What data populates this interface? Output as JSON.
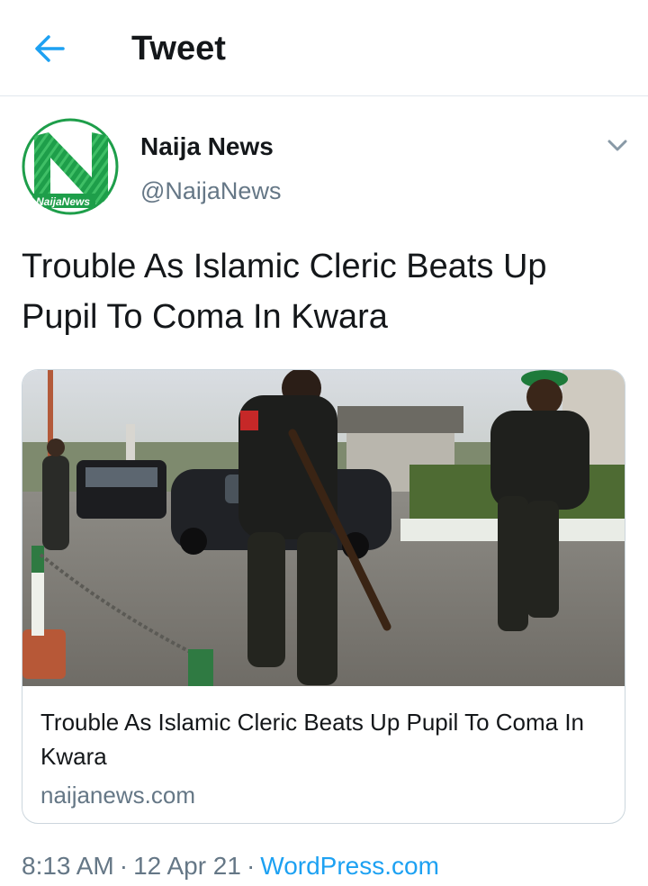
{
  "header": {
    "title": "Tweet",
    "back_icon": "arrow-left-icon",
    "accent": "#1da1f2"
  },
  "author": {
    "name": "Naija News",
    "handle": "@NaijaNews",
    "avatar_logo_text": "NaijaNews",
    "avatar_colors": {
      "green": "#1e9e4a",
      "dark": "#0f6b2e"
    }
  },
  "tweet": {
    "text": "Trouble As Islamic Cleric Beats Up Pupil To Coma In Kwara"
  },
  "card": {
    "title": "Trouble As Islamic Cleric Beats Up Pupil To Coma In Kwara",
    "domain": "naijanews.com",
    "image_description_icon": "news-photo"
  },
  "meta": {
    "time": "8:13 AM",
    "separator": "·",
    "date": "12 Apr 21",
    "source": "WordPress.com",
    "source_color": "#1da1f2"
  }
}
